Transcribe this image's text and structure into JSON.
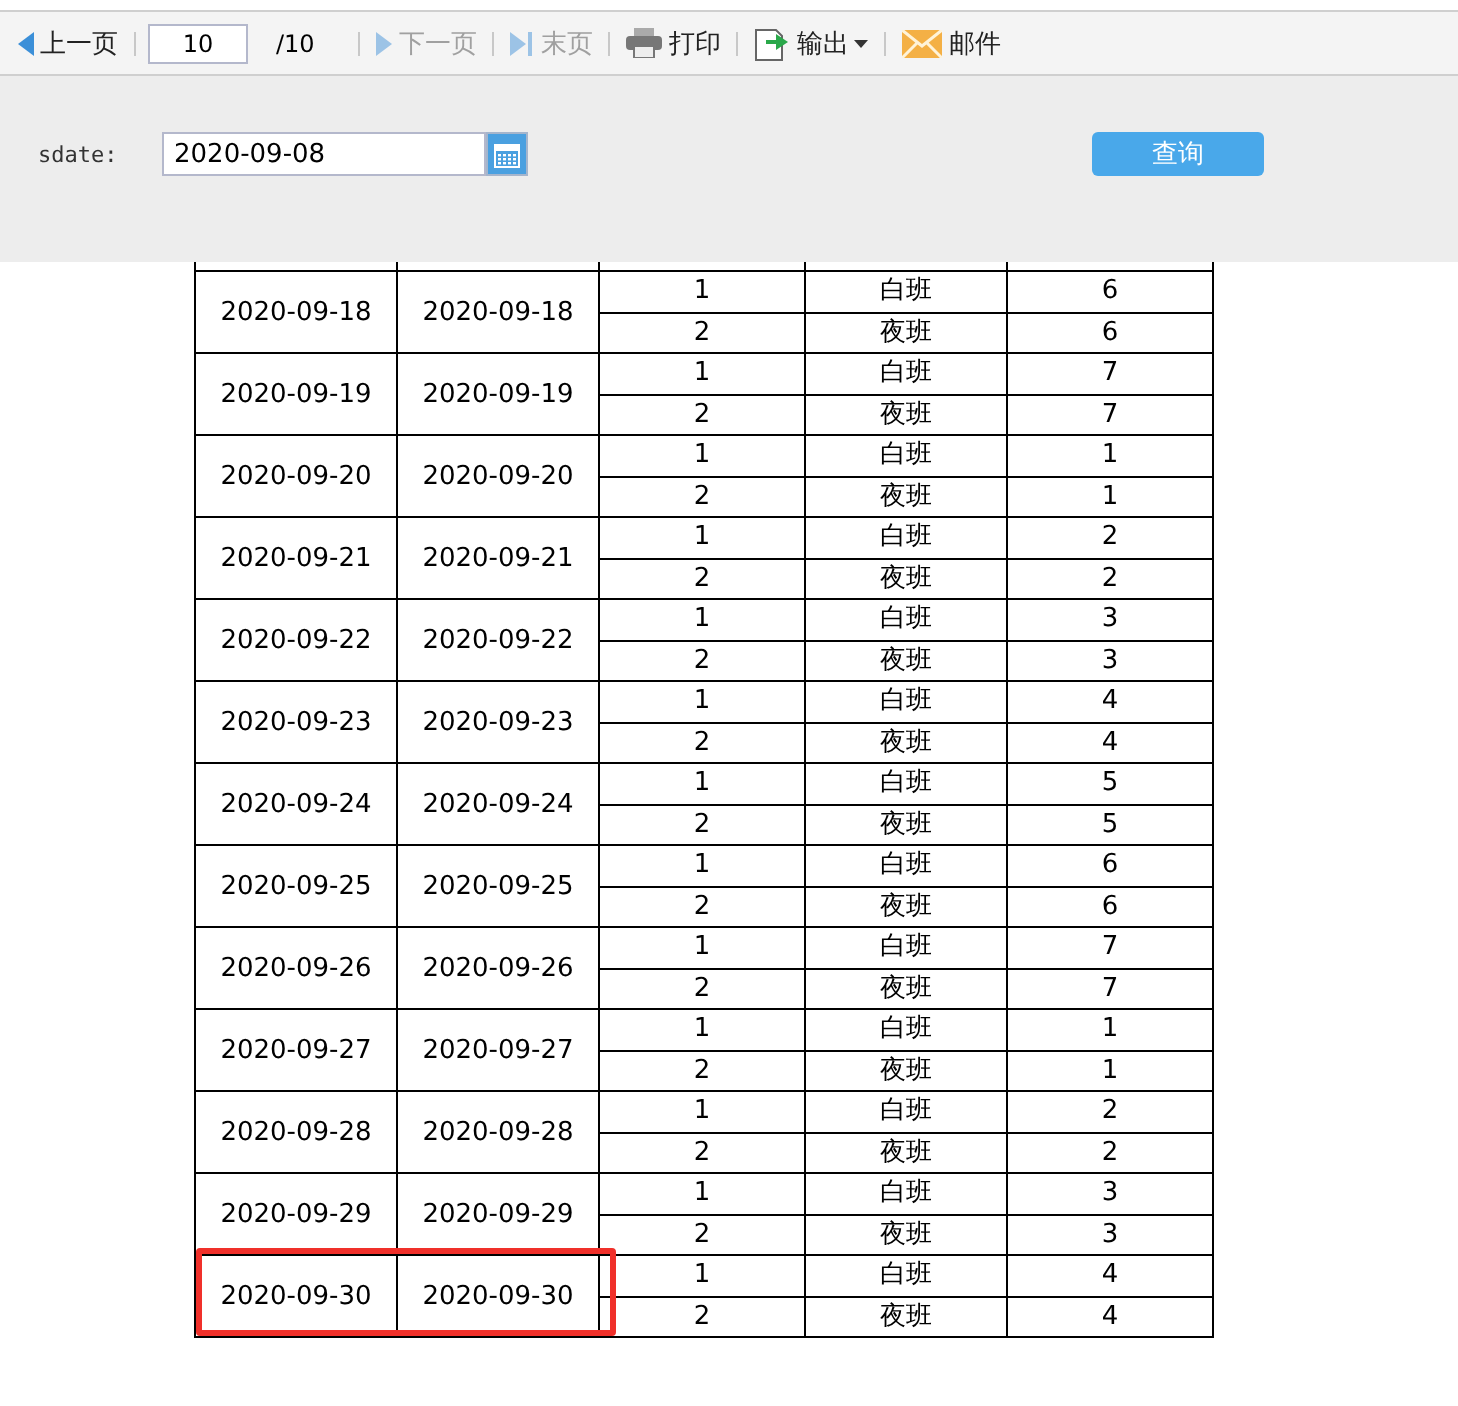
{
  "toolbar": {
    "items": [
      {
        "kind": "prev",
        "label": "上一页",
        "disabled": false
      },
      {
        "kind": "page",
        "value": "10",
        "total": "/10"
      },
      {
        "kind": "next",
        "label": "下一页",
        "disabled": true
      },
      {
        "kind": "last",
        "label": "末页",
        "disabled": true
      },
      {
        "kind": "print",
        "label": "打印",
        "disabled": false
      },
      {
        "kind": "export",
        "label": "输出",
        "disabled": false
      },
      {
        "kind": "mail",
        "label": "邮件",
        "disabled": false
      }
    ]
  },
  "form": {
    "label": "sdate:",
    "value": "2020-09-08",
    "button": "查询"
  },
  "table": {
    "groups": [
      {
        "date_1": "2020-09-18",
        "date_2": "2020-09-18",
        "highlighted": false,
        "rows": [
          {
            "no": "1",
            "shift": "白班",
            "value": "6"
          },
          {
            "no": "2",
            "shift": "夜班",
            "value": "6"
          }
        ]
      },
      {
        "date_1": "2020-09-19",
        "date_2": "2020-09-19",
        "highlighted": false,
        "rows": [
          {
            "no": "1",
            "shift": "白班",
            "value": "7"
          },
          {
            "no": "2",
            "shift": "夜班",
            "value": "7"
          }
        ]
      },
      {
        "date_1": "2020-09-20",
        "date_2": "2020-09-20",
        "highlighted": false,
        "rows": [
          {
            "no": "1",
            "shift": "白班",
            "value": "1"
          },
          {
            "no": "2",
            "shift": "夜班",
            "value": "1"
          }
        ]
      },
      {
        "date_1": "2020-09-21",
        "date_2": "2020-09-21",
        "highlighted": false,
        "rows": [
          {
            "no": "1",
            "shift": "白班",
            "value": "2"
          },
          {
            "no": "2",
            "shift": "夜班",
            "value": "2"
          }
        ]
      },
      {
        "date_1": "2020-09-22",
        "date_2": "2020-09-22",
        "highlighted": false,
        "rows": [
          {
            "no": "1",
            "shift": "白班",
            "value": "3"
          },
          {
            "no": "2",
            "shift": "夜班",
            "value": "3"
          }
        ]
      },
      {
        "date_1": "2020-09-23",
        "date_2": "2020-09-23",
        "highlighted": false,
        "rows": [
          {
            "no": "1",
            "shift": "白班",
            "value": "4"
          },
          {
            "no": "2",
            "shift": "夜班",
            "value": "4"
          }
        ]
      },
      {
        "date_1": "2020-09-24",
        "date_2": "2020-09-24",
        "highlighted": false,
        "rows": [
          {
            "no": "1",
            "shift": "白班",
            "value": "5"
          },
          {
            "no": "2",
            "shift": "夜班",
            "value": "5"
          }
        ]
      },
      {
        "date_1": "2020-09-25",
        "date_2": "2020-09-25",
        "highlighted": false,
        "rows": [
          {
            "no": "1",
            "shift": "白班",
            "value": "6"
          },
          {
            "no": "2",
            "shift": "夜班",
            "value": "6"
          }
        ]
      },
      {
        "date_1": "2020-09-26",
        "date_2": "2020-09-26",
        "highlighted": false,
        "rows": [
          {
            "no": "1",
            "shift": "白班",
            "value": "7"
          },
          {
            "no": "2",
            "shift": "夜班",
            "value": "7"
          }
        ]
      },
      {
        "date_1": "2020-09-27",
        "date_2": "2020-09-27",
        "highlighted": false,
        "rows": [
          {
            "no": "1",
            "shift": "白班",
            "value": "1"
          },
          {
            "no": "2",
            "shift": "夜班",
            "value": "1"
          }
        ]
      },
      {
        "date_1": "2020-09-28",
        "date_2": "2020-09-28",
        "highlighted": false,
        "rows": [
          {
            "no": "1",
            "shift": "白班",
            "value": "2"
          },
          {
            "no": "2",
            "shift": "夜班",
            "value": "2"
          }
        ]
      },
      {
        "date_1": "2020-09-29",
        "date_2": "2020-09-29",
        "highlighted": false,
        "rows": [
          {
            "no": "1",
            "shift": "白班",
            "value": "3"
          },
          {
            "no": "2",
            "shift": "夜班",
            "value": "3"
          }
        ]
      },
      {
        "date_1": "2020-09-30",
        "date_2": "2020-09-30",
        "highlighted": true,
        "rows": [
          {
            "no": "1",
            "shift": "白班",
            "value": "4"
          },
          {
            "no": "2",
            "shift": "夜班",
            "value": "4"
          }
        ]
      }
    ]
  }
}
